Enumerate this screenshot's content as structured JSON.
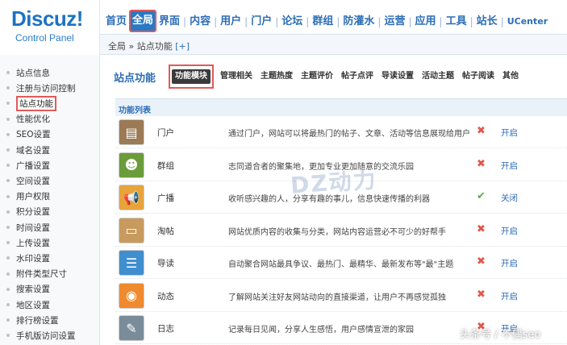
{
  "logo": {
    "name": "Discuz!",
    "subtitle": "Control Panel"
  },
  "nav": {
    "items": [
      {
        "label": "首页",
        "active": false
      },
      {
        "label": "全局",
        "active": true
      },
      {
        "label": "界面",
        "active": false
      },
      {
        "label": "内容",
        "active": false
      },
      {
        "label": "用户",
        "active": false
      },
      {
        "label": "门户",
        "active": false
      },
      {
        "label": "论坛",
        "active": false
      },
      {
        "label": "群组",
        "active": false
      },
      {
        "label": "防灌水",
        "active": false
      },
      {
        "label": "运营",
        "active": false
      },
      {
        "label": "应用",
        "active": false
      },
      {
        "label": "工具",
        "active": false
      },
      {
        "label": "站长",
        "active": false
      },
      {
        "label": "UCenter",
        "active": false
      }
    ]
  },
  "breadcrumb": {
    "path": "全局 » 站点功能",
    "add": "[+]"
  },
  "sidebar": {
    "items": [
      {
        "label": "站点信息",
        "active": false
      },
      {
        "label": "注册与访问控制",
        "active": false
      },
      {
        "label": "站点功能",
        "active": true
      },
      {
        "label": "性能优化",
        "active": false
      },
      {
        "label": "SEO设置",
        "active": false
      },
      {
        "label": "域名设置",
        "active": false
      },
      {
        "label": "广播设置",
        "active": false
      },
      {
        "label": "空间设置",
        "active": false
      },
      {
        "label": "用户权限",
        "active": false
      },
      {
        "label": "积分设置",
        "active": false
      },
      {
        "label": "时间设置",
        "active": false
      },
      {
        "label": "上传设置",
        "active": false
      },
      {
        "label": "水印设置",
        "active": false
      },
      {
        "label": "附件类型尺寸",
        "active": false
      },
      {
        "label": "搜索设置",
        "active": false
      },
      {
        "label": "地区设置",
        "active": false
      },
      {
        "label": "排行榜设置",
        "active": false
      },
      {
        "label": "手机版访问设置",
        "active": false
      }
    ]
  },
  "main": {
    "title": "站点功能",
    "tabs": [
      {
        "label": "功能模块",
        "active": true
      },
      {
        "label": "管理相关",
        "active": false
      },
      {
        "label": "主题热度",
        "active": false
      },
      {
        "label": "主题评价",
        "active": false
      },
      {
        "label": "帖子点评",
        "active": false
      },
      {
        "label": "导读设置",
        "active": false
      },
      {
        "label": "活动主题",
        "active": false
      },
      {
        "label": "帖子阅读",
        "active": false
      },
      {
        "label": "其他",
        "active": false
      }
    ],
    "list_title": "功能列表",
    "rows": [
      {
        "icon": "portal-icon",
        "name": "门户",
        "desc": "通过门户，网站可以将最热门的帖子、文章、活动等信息展现给用户",
        "status": "off",
        "status_glyph": "✖",
        "action": "开启",
        "color": "#9b7a55"
      },
      {
        "icon": "group-icon",
        "name": "群组",
        "desc": "志同道合者的聚集地，更加专业更加随意的交流乐园",
        "status": "off",
        "status_glyph": "✖",
        "action": "开启",
        "color": "#6a9c3a"
      },
      {
        "icon": "broadcast-icon",
        "name": "广播",
        "desc": "收听感兴趣的人，分享有趣的事儿，信息快速传播的利器",
        "status": "on",
        "status_glyph": "✔",
        "action": "关闭",
        "color": "#e8a33a"
      },
      {
        "icon": "collection-icon",
        "name": "淘帖",
        "desc": "网站优质内容的收集与分类，网站内容运营必不可少的好帮手",
        "status": "off",
        "status_glyph": "✖",
        "action": "开启",
        "color": "#c89a5e"
      },
      {
        "icon": "guide-icon",
        "name": "导读",
        "desc": "自动聚合网站最具争议、最热门、最精华、最新发布等\"最\"主题",
        "status": "off",
        "status_glyph": "✖",
        "action": "开启",
        "color": "#3f8fd0"
      },
      {
        "icon": "feed-icon",
        "name": "动态",
        "desc": "了解网站关注好友网站动向的直接渠道，让用户不再感觉孤独",
        "status": "off",
        "status_glyph": "✖",
        "action": "开启",
        "color": "#f08a2e"
      },
      {
        "icon": "blog-icon",
        "name": "日志",
        "desc": "记录每日见闻，分享人生感悟，用户感情宣泄的家园",
        "status": "off",
        "status_glyph": "✖",
        "action": "开启",
        "color": "#7a8c9a"
      }
    ]
  },
  "watermark": "DZ动力",
  "source_mark": "头条号 / 不偶seo"
}
